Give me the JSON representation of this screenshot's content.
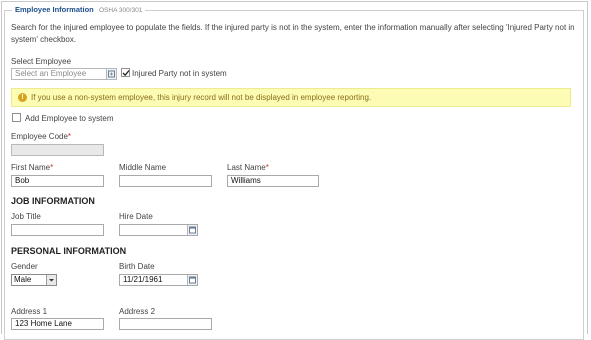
{
  "section": {
    "title": "Employee Information",
    "subtitle": "OSHA 300/301",
    "intro": "Search for the injured employee to populate the fields. If the injured party is not in the system, enter the information manually after selecting 'Injured Party not in system' checkbox."
  },
  "select_employee": {
    "label": "Select Employee",
    "placeholder": "Select an Employee",
    "not_in_system_label": "Injured Party not in system",
    "not_in_system_checked": true
  },
  "warning": {
    "text": "If you use a non-system employee, this injury record will not be displayed in employee reporting."
  },
  "add_employee": {
    "label": "Add Employee to system",
    "checked": false
  },
  "employee_code": {
    "label": "Employee Code",
    "required_mark": "*",
    "value": ""
  },
  "name": {
    "first_label": "First Name",
    "first_req": "*",
    "first_value": "Bob",
    "middle_label": "Middle Name",
    "middle_value": "",
    "last_label": "Last Name",
    "last_req": "*",
    "last_value": "Williams"
  },
  "job": {
    "heading": "JOB INFORMATION",
    "title_label": "Job Title",
    "title_value": "",
    "hire_label": "Hire Date",
    "hire_value": ""
  },
  "personal": {
    "heading": "PERSONAL INFORMATION",
    "gender_label": "Gender",
    "gender_value": "Male",
    "birth_label": "Birth Date",
    "birth_value": "11/21/1961",
    "address1_label": "Address 1",
    "address1_value": "123 Home Lane",
    "address2_label": "Address 2",
    "address2_value": ""
  },
  "colors": {
    "legend": "#1e4f8c",
    "required": "#c0392b",
    "warning_bg": "#fcfcb4",
    "warning_icon": "#d6a31f"
  },
  "icons": [
    "calendar-icon",
    "lookup-icon",
    "check-icon",
    "warning-icon",
    "dropdown-arrow-icon"
  ]
}
